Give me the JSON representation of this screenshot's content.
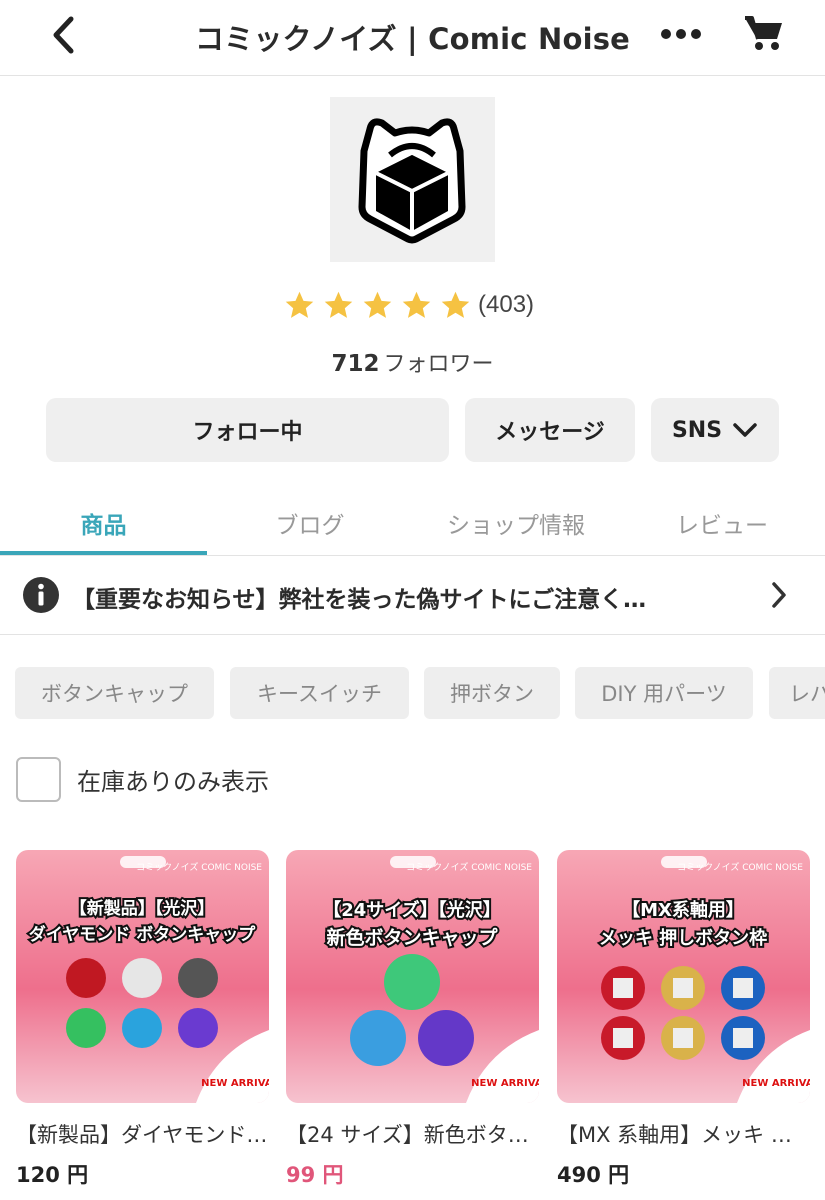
{
  "header": {
    "title": "コミックノイズ | Comic Noise",
    "back_icon": "chevron-left-icon",
    "more_icon": "ellipsis-icon",
    "cart_icon": "cart-icon"
  },
  "shop": {
    "rating_value": 5,
    "rating_max": 5,
    "rating_count": "(403)",
    "followers_count": "712",
    "followers_label": "フォロワー"
  },
  "actions": {
    "follow_label": "フォロー中",
    "message_label": "メッセージ",
    "sns_label": "SNS"
  },
  "tabs": [
    {
      "label": "商品",
      "active": true
    },
    {
      "label": "ブログ",
      "active": false
    },
    {
      "label": "ショップ情報",
      "active": false
    },
    {
      "label": "レビュー",
      "active": false
    }
  ],
  "notice": {
    "text": "【重要なお知らせ】弊社を装った偽サイトにご注意く…"
  },
  "chips": [
    "ボタンキャップ",
    "キースイッチ",
    "押ボタン",
    "DIY 用パーツ",
    "レバ"
  ],
  "filter": {
    "stock_only_label": "在庫ありのみ表示",
    "checked": false
  },
  "products": [
    {
      "name": "【新製品】ダイヤモンド…",
      "price": "120 円",
      "sale": false,
      "image_headline1": "【新製品】【光沢】",
      "image_headline2": "ダイヤモンド ボタンキャップ",
      "image_brand": "コミックノイズ COMIC NOISE",
      "image_badge": "NEW ARRIVAL"
    },
    {
      "name": "【24 サイズ】新色ボタ…",
      "price": "99 円",
      "sale": true,
      "image_headline1": "【24サイズ】【光沢】",
      "image_headline2": "新色ボタンキャップ",
      "image_brand": "コミックノイズ COMIC NOISE",
      "image_badge": "NEW ARRIVAL"
    },
    {
      "name": "【MX 系軸用】メッキ 押…",
      "price": "490 円",
      "sale": false,
      "image_headline1": "【MX系軸用】",
      "image_headline2": "メッキ 押しボタン枠",
      "image_brand": "コミックノイズ COMIC NOISE",
      "image_badge": "NEW ARRIVAL"
    }
  ],
  "colors": {
    "accent": "#3aa6b9",
    "sale_price": "#e0567a",
    "star": "#f5c242",
    "chip_bg": "#eeeeee",
    "button_bg": "#efefef"
  }
}
